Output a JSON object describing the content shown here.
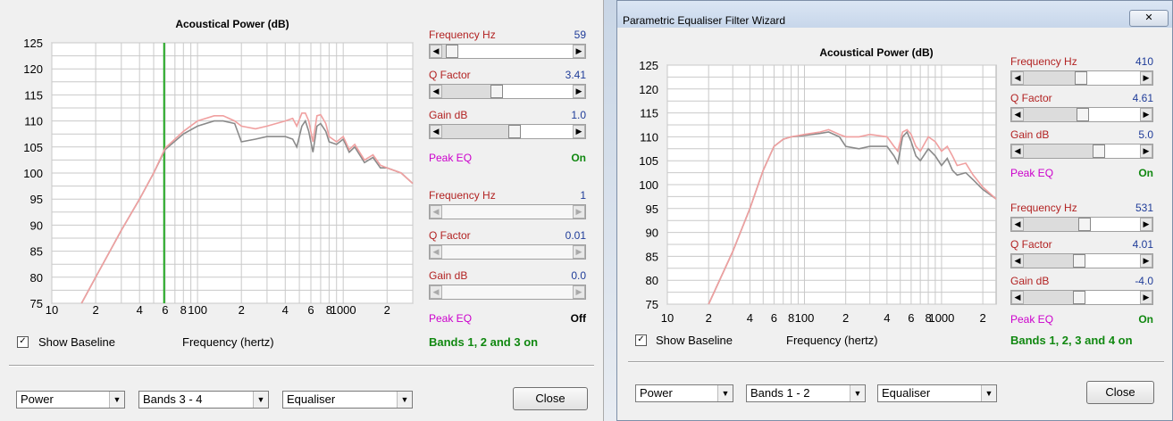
{
  "panels": [
    {
      "chart": {
        "title": "Acoustical Power (dB)",
        "xlabel": "Frequency (hertz)",
        "y_ticks": [
          "125",
          "120",
          "115",
          "110",
          "105",
          "100",
          "95",
          "90",
          "85",
          "80",
          "75"
        ],
        "x_ticks": [
          {
            "f": 10,
            "label": "10"
          },
          {
            "f": 20,
            "label": "2"
          },
          {
            "f": 40,
            "label": "4"
          },
          {
            "f": 60,
            "label": "6"
          },
          {
            "f": 80,
            "label": "8"
          },
          {
            "f": 100,
            "label": "100"
          },
          {
            "f": 200,
            "label": "2"
          },
          {
            "f": 400,
            "label": "4"
          },
          {
            "f": 600,
            "label": "6"
          },
          {
            "f": 800,
            "label": "8"
          },
          {
            "f": 1000,
            "label": "1000"
          },
          {
            "f": 2000,
            "label": "2"
          }
        ],
        "marker_freq": 59
      },
      "controls": [
        {
          "label": "Frequency  Hz",
          "value": "59",
          "level": 0.03
        },
        {
          "label": "Q Factor",
          "value": "3.41",
          "level": 0.4
        },
        {
          "label": "Gain  dB",
          "value": "1.0",
          "level": 0.55
        },
        {
          "label": "Peak EQ",
          "value": "On",
          "state": "on"
        },
        {
          "label": "Frequency  Hz",
          "value": "1",
          "level": 0.0,
          "disabled": true
        },
        {
          "label": "Q Factor",
          "value": "0.01",
          "level": 0.0,
          "disabled": true
        },
        {
          "label": "Gain  dB",
          "value": "0.0",
          "level": 0.0,
          "disabled": true
        },
        {
          "label": "Peak EQ",
          "value": "Off",
          "state": "off"
        }
      ],
      "show_baseline": "Show Baseline",
      "bands_status": "Bands 1, 2 and 3 on",
      "dropdowns": [
        "Power",
        "Bands 3 - 4",
        "Equaliser"
      ],
      "close_label": "Close"
    },
    {
      "window_title": "Parametric Equaliser Filter Wizard",
      "chart": {
        "title": "Acoustical Power (dB)",
        "xlabel": "Frequency (hertz)",
        "y_ticks": [
          "125",
          "120",
          "115",
          "110",
          "105",
          "100",
          "95",
          "90",
          "85",
          "80",
          "75"
        ],
        "x_ticks": [
          {
            "f": 10,
            "label": "10"
          },
          {
            "f": 20,
            "label": "2"
          },
          {
            "f": 40,
            "label": "4"
          },
          {
            "f": 60,
            "label": "6"
          },
          {
            "f": 80,
            "label": "8"
          },
          {
            "f": 100,
            "label": "100"
          },
          {
            "f": 200,
            "label": "2"
          },
          {
            "f": 400,
            "label": "4"
          },
          {
            "f": 600,
            "label": "6"
          },
          {
            "f": 800,
            "label": "8"
          },
          {
            "f": 1000,
            "label": "1000"
          },
          {
            "f": 2000,
            "label": "2"
          }
        ]
      },
      "controls": [
        {
          "label": "Frequency  Hz",
          "value": "410",
          "level": 0.48
        },
        {
          "label": "Q Factor",
          "value": "4.61",
          "level": 0.5
        },
        {
          "label": "Gain  dB",
          "value": "5.0",
          "level": 0.65
        },
        {
          "label": "Peak EQ",
          "value": "On",
          "state": "on"
        },
        {
          "label": "Frequency  Hz",
          "value": "531",
          "level": 0.52
        },
        {
          "label": "Q Factor",
          "value": "4.01",
          "level": 0.47
        },
        {
          "label": "Gain  dB",
          "value": "-4.0",
          "level": 0.47
        },
        {
          "label": "Peak EQ",
          "value": "On",
          "state": "on"
        }
      ],
      "show_baseline": "Show Baseline",
      "bands_status": "Bands 1, 2, 3 and 4 on",
      "dropdowns": [
        "Power",
        "Bands 1 - 2",
        "Equaliser"
      ],
      "close_label": "Close"
    }
  ],
  "colors": {
    "baseline": "#8a8a8a",
    "eq": "#f0a0a0",
    "marker": "#22aa22",
    "label": "#b22222",
    "value": "#1f3c99",
    "peak": "#cc00cc",
    "on": "#118811"
  },
  "chart_data": [
    {
      "type": "line",
      "title": "Acoustical Power (dB)",
      "xlabel": "Frequency (hertz)",
      "ylabel": "",
      "xscale": "log",
      "xlim": [
        10,
        3000
      ],
      "ylim": [
        75,
        125
      ],
      "grid": true,
      "series": [
        {
          "points": [
            [
              16,
              75
            ],
            [
              20,
              80
            ],
            [
              30,
              89
            ],
            [
              40,
              95
            ],
            [
              50,
              100
            ],
            [
              60,
              104.5
            ],
            [
              80,
              107.5
            ],
            [
              100,
              109
            ],
            [
              130,
              110
            ],
            [
              150,
              110
            ],
            [
              180,
              109.5
            ],
            [
              200,
              106
            ],
            [
              250,
              106.5
            ],
            [
              300,
              107
            ],
            [
              400,
              107
            ],
            [
              450,
              106.5
            ],
            [
              480,
              105
            ],
            [
              520,
              109
            ],
            [
              550,
              110
            ],
            [
              580,
              108
            ],
            [
              620,
              104
            ],
            [
              660,
              109
            ],
            [
              700,
              109.5
            ],
            [
              760,
              108
            ],
            [
              800,
              106
            ],
            [
              900,
              105.5
            ],
            [
              1000,
              106.5
            ],
            [
              1100,
              104
            ],
            [
              1200,
              105
            ],
            [
              1400,
              102
            ],
            [
              1600,
              103
            ],
            [
              1800,
              101
            ],
            [
              2000,
              101
            ],
            [
              2500,
              100
            ],
            [
              3000,
              98
            ]
          ]
        },
        {
          "points": [
            [
              16,
              75
            ],
            [
              20,
              80
            ],
            [
              30,
              89
            ],
            [
              40,
              95
            ],
            [
              50,
              100
            ],
            [
              60,
              104.8
            ],
            [
              80,
              108
            ],
            [
              100,
              110
            ],
            [
              130,
              111
            ],
            [
              150,
              111
            ],
            [
              180,
              110
            ],
            [
              200,
              109
            ],
            [
              250,
              108.5
            ],
            [
              300,
              109
            ],
            [
              400,
              110
            ],
            [
              450,
              110.5
            ],
            [
              480,
              109
            ],
            [
              520,
              111.5
            ],
            [
              550,
              111.5
            ],
            [
              580,
              110
            ],
            [
              620,
              106
            ],
            [
              660,
              111
            ],
            [
              700,
              111.2
            ],
            [
              760,
              109.5
            ],
            [
              800,
              107
            ],
            [
              900,
              106
            ],
            [
              1000,
              107
            ],
            [
              1100,
              104.5
            ],
            [
              1200,
              105.5
            ],
            [
              1400,
              102.5
            ],
            [
              1600,
              103.5
            ],
            [
              1800,
              101.5
            ],
            [
              2000,
              101
            ],
            [
              2500,
              100
            ],
            [
              3000,
              98
            ]
          ]
        }
      ]
    },
    {
      "type": "line",
      "title": "Acoustical Power (dB)",
      "xlabel": "Frequency (hertz)",
      "ylabel": "",
      "xscale": "log",
      "xlim": [
        10,
        2500
      ],
      "ylim": [
        75,
        125
      ],
      "grid": true,
      "series": [
        {
          "points": [
            [
              20,
              75
            ],
            [
              30,
              86
            ],
            [
              40,
              95
            ],
            [
              50,
              103
            ],
            [
              60,
              108
            ],
            [
              70,
              109.5
            ],
            [
              80,
              110
            ],
            [
              100,
              110.3
            ],
            [
              130,
              110.7
            ],
            [
              150,
              111
            ],
            [
              180,
              110
            ],
            [
              200,
              108
            ],
            [
              250,
              107.5
            ],
            [
              300,
              108
            ],
            [
              400,
              108
            ],
            [
              450,
              106
            ],
            [
              480,
              104.5
            ],
            [
              520,
              110
            ],
            [
              560,
              111
            ],
            [
              600,
              109
            ],
            [
              650,
              106
            ],
            [
              700,
              105
            ],
            [
              800,
              107.5
            ],
            [
              900,
              106
            ],
            [
              1000,
              104
            ],
            [
              1100,
              105.5
            ],
            [
              1200,
              103
            ],
            [
              1300,
              102
            ],
            [
              1500,
              102.5
            ],
            [
              1700,
              101
            ],
            [
              2000,
              99
            ],
            [
              2500,
              97
            ]
          ]
        },
        {
          "points": [
            [
              20,
              75
            ],
            [
              30,
              86
            ],
            [
              40,
              95
            ],
            [
              50,
              103
            ],
            [
              60,
              108
            ],
            [
              70,
              109.5
            ],
            [
              80,
              110
            ],
            [
              100,
              110.5
            ],
            [
              130,
              111
            ],
            [
              150,
              111.5
            ],
            [
              180,
              110.5
            ],
            [
              200,
              110
            ],
            [
              250,
              110
            ],
            [
              300,
              110.5
            ],
            [
              400,
              110
            ],
            [
              450,
              108
            ],
            [
              480,
              107
            ],
            [
              520,
              111
            ],
            [
              560,
              111.5
            ],
            [
              600,
              110.5
            ],
            [
              650,
              108
            ],
            [
              700,
              107
            ],
            [
              800,
              110
            ],
            [
              900,
              109
            ],
            [
              1000,
              107
            ],
            [
              1100,
              108
            ],
            [
              1200,
              106
            ],
            [
              1300,
              104
            ],
            [
              1500,
              104.5
            ],
            [
              1700,
              102
            ],
            [
              2000,
              99.5
            ],
            [
              2500,
              97
            ]
          ]
        }
      ]
    }
  ]
}
